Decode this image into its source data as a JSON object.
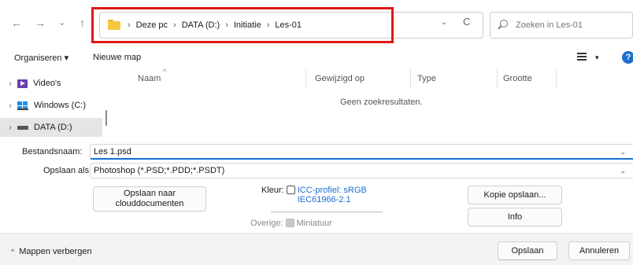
{
  "addressbar": {
    "back": "←",
    "forward": "→",
    "recent": "⌄",
    "up": "↑",
    "crumbs": [
      "Deze pc",
      "DATA (D:)",
      "Initiatie",
      "Les-01"
    ],
    "separator": "›",
    "dropdown": "⌄",
    "refresh": "C",
    "search_placeholder": "Zoeken in Les-01"
  },
  "toolbar": {
    "organize": "Organiseren ▾",
    "new_folder": "Nieuwe map",
    "view_caret": "▾",
    "help": "?"
  },
  "nav_pane": {
    "items": [
      {
        "label": "Video's",
        "chevron": "›",
        "icon": "video-icon"
      },
      {
        "label": "Windows (C:)",
        "chevron": "›",
        "icon": "windows-drive-icon"
      },
      {
        "label": "DATA (D:)",
        "chevron": "›",
        "icon": "drive-icon"
      }
    ]
  },
  "file_list": {
    "columns": [
      "Naam",
      "Gewijzigd op",
      "Type",
      "Grootte"
    ],
    "sort_indicator": "^",
    "empty_message": "Geen zoekresultaten."
  },
  "filename": {
    "label": "Bestandsnaam:",
    "value": "Les 1.psd",
    "caret": "⌄"
  },
  "save_as": {
    "label": "Opslaan als:",
    "value": "Photoshop (*.PSD;*.PDD;*.PSDT)",
    "caret": "⌄"
  },
  "options": {
    "cloud_button": "Opslaan naar clouddocumenten",
    "color_label": "Kleur:",
    "icc_profile": "ICC-profiel:  sRGB IEC61966-2.1",
    "other_label": "Overige:",
    "thumbnail": "Miniatuur",
    "save_copy_button": "Kopie opslaan...",
    "info_button": "Info"
  },
  "footer": {
    "hide_folders": "Mappen verbergen",
    "hide_caret": "^",
    "save_button": "Opslaan",
    "cancel_button": "Annuleren"
  },
  "colors": {
    "highlight": "#e01818",
    "accent": "#1a6fd0"
  }
}
